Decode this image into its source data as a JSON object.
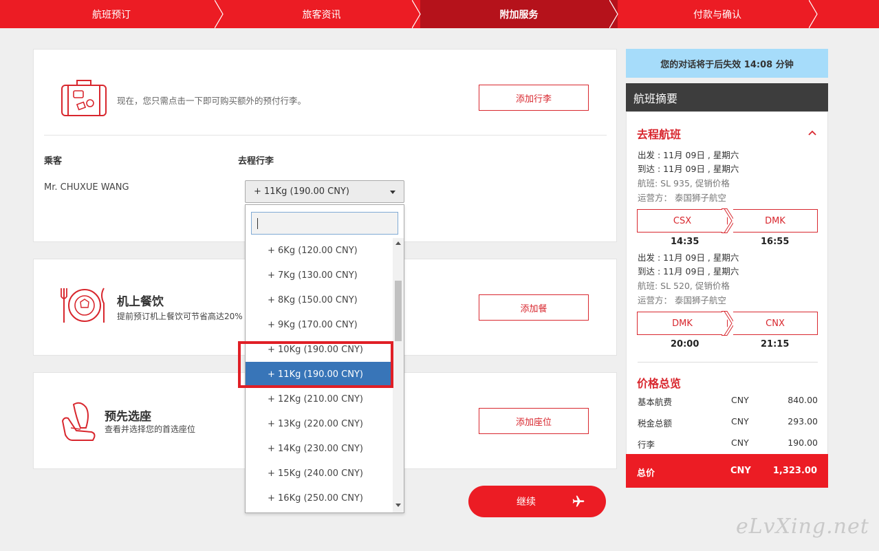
{
  "steps": [
    "航班预订",
    "旅客资讯",
    "附加服务",
    "付款与确认"
  ],
  "active_step_index": 2,
  "baggage": {
    "description": "现在，您只需点击一下即可购买额外的预付行李。",
    "add_button": "添加行李",
    "col_passenger": "乘客",
    "col_outbound": "去程行李",
    "passenger_name": "Mr. CHUXUE WANG",
    "selected": "+ 11Kg (190.00 CNY)",
    "search_value": "",
    "options": [
      "+ 6Kg (120.00 CNY)",
      "+ 7Kg (130.00 CNY)",
      "+ 8Kg (150.00 CNY)",
      "+ 9Kg (170.00 CNY)",
      "+ 10Kg (190.00 CNY)",
      "+ 11Kg (190.00 CNY)",
      "+ 12Kg (210.00 CNY)",
      "+ 13Kg (220.00 CNY)",
      "+ 14Kg (230.00 CNY)",
      "+ 15Kg (240.00 CNY)",
      "+ 16Kg (250.00 CNY)"
    ],
    "selected_index": 5
  },
  "meal": {
    "title": "机上餐饮",
    "subtitle": "提前预订机上餐饮可节省高达20%",
    "add_button": "添加餐"
  },
  "seat": {
    "title": "预先选座",
    "subtitle": "查看并选择您的首选座位",
    "add_button": "添加座位"
  },
  "continue_label": "继续",
  "timer_text": "您的对话将于后失效 14:08 分钟",
  "summary": {
    "heading": "航班摘要",
    "outbound_title": "去程航班",
    "flights": [
      {
        "depart": "出发 : 11月 09日 , 星期六",
        "arrive": "到达 : 11月 09日 , 星期六",
        "flight": "航班: SL 935, 促销价格",
        "operator": "运营方： 泰国狮子航空",
        "from": "CSX",
        "to": "DMK",
        "dep_time": "14:35",
        "arr_time": "16:55"
      },
      {
        "depart": "出发 : 11月 09日 , 星期六",
        "arrive": "到达 : 11月 09日 , 星期六",
        "flight": "航班: SL 520, 促销价格",
        "operator": "运营方： 泰国狮子航空",
        "from": "DMK",
        "to": "CNX",
        "dep_time": "20:00",
        "arr_time": "21:15"
      }
    ],
    "price_title": "价格总览",
    "prices": [
      {
        "label": "基本航费",
        "currency": "CNY",
        "amount": "840.00"
      },
      {
        "label": "税金总额",
        "currency": "CNY",
        "amount": "293.00"
      },
      {
        "label": "行李",
        "currency": "CNY",
        "amount": "190.00"
      }
    ],
    "total_label": "总价",
    "total_currency": "CNY",
    "total_amount": "1,323.00"
  },
  "watermark": "eLvXing.net",
  "colors": {
    "brand_red": "#ec1c24",
    "active_step": "#b5121b",
    "selected_option": "#3875b8",
    "timer_bg": "#a6dcfa"
  }
}
